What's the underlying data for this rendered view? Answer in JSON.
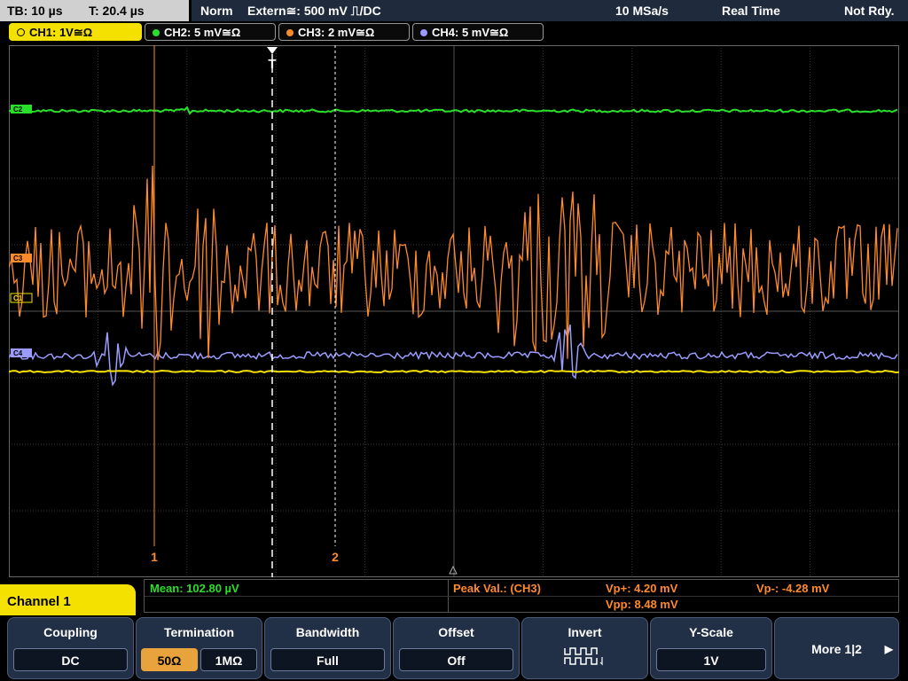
{
  "top": {
    "tb": "TB: 10 µs",
    "t": "T: 20.4 µs",
    "mode": "Norm",
    "trigger": "Extern≅: 500 mV ⎍/DC",
    "rate": "10 MSa/s",
    "acq": "Real Time",
    "status": "Not Rdy."
  },
  "tabs": [
    {
      "label": "CH1: 1V≅Ω",
      "color": "#f4e100"
    },
    {
      "label": "CH2: 5 mV≅Ω",
      "color": "#2adf2a"
    },
    {
      "label": "CH3: 2 mV≅Ω",
      "color": "#ff8a2a"
    },
    {
      "label": "CH4: 5 mV≅Ω",
      "color": "#9b9bff"
    }
  ],
  "markers": {
    "cursor1": "1",
    "cursor2": "2",
    "trigger": "T"
  },
  "channel_tags": {
    "ch1": "C1",
    "ch2": "C2",
    "ch3": "C3",
    "ch4": "C4"
  },
  "measurements": {
    "mean": "Mean: 102.80 µV",
    "peak_label": "Peak Val.:  (CH3)",
    "vp_plus": "Vp+: 4.20 mV",
    "vpp": "Vpp: 8.48 mV",
    "vp_minus": "Vp-: -4.28 mV"
  },
  "menu": {
    "channel": "Channel 1",
    "coupling": {
      "title": "Coupling",
      "value": "DC"
    },
    "termination": {
      "title": "Termination",
      "opt1": "50Ω",
      "opt2": "1MΩ"
    },
    "bandwidth": {
      "title": "Bandwidth",
      "value": "Full"
    },
    "offset": {
      "title": "Offset",
      "value": "Off"
    },
    "invert": {
      "title": "Invert"
    },
    "yscale": {
      "title": "Y-Scale",
      "value": "1V"
    },
    "more": "More 1|2"
  },
  "colors": {
    "ch1": "#f4e100",
    "ch2": "#2adf2a",
    "ch3": "#ff8a2a",
    "ch4": "#9b9bff",
    "grid": "#444444"
  }
}
